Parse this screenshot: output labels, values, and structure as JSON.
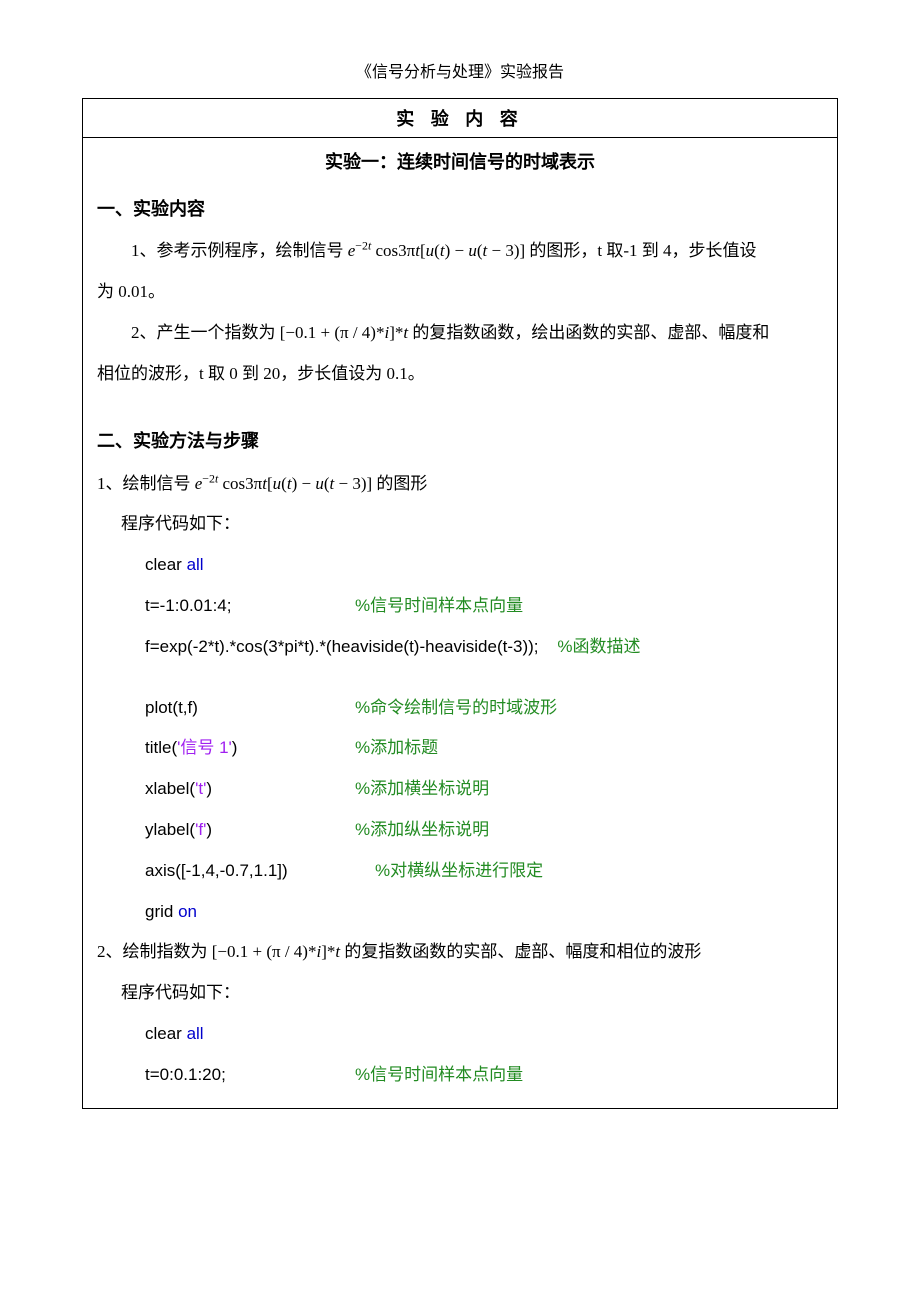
{
  "header": "《信号分析与处理》实验报告",
  "box_title": "实 验 内 容",
  "experiment_title": "实验一：连续时间信号的时域表示",
  "s1": {
    "heading": "一、实验内容",
    "item1_pre": "1、参考示例程序，绘制信号",
    "item1_formula_html": "<span class='formula'>e</span><sup>−2<span class='formula'>t</span></sup> cos3π<span class='formula'>t</span>[<span class='formula'>u</span>(<span class='formula'>t</span>) − <span class='formula'>u</span>(<span class='formula'>t</span> − 3)]",
    "item1_post": "的图形，t 取-1 到 4，步长值设",
    "item1_tail": "为 0.01。",
    "item2_pre": "2、产生一个指数为",
    "item2_formula_html": "[−0.1 + (π / 4)*<span class='formula'>i</span>]*<span class='formula'>t</span>",
    "item2_post": "的复指数函数，绘出函数的实部、虚部、幅度和",
    "item2_tail": "相位的波形，t 取 0 到 20，步长值设为 0.1。"
  },
  "s2": {
    "heading": "二、实验方法与步骤",
    "p1_pre": "1、绘制信号",
    "p1_formula_html": "<span class='formula'>e</span><sup>−2<span class='formula'>t</span></sup> cos3π<span class='formula'>t</span>[<span class='formula'>u</span>(<span class='formula'>t</span>) − <span class='formula'>u</span>(<span class='formula'>t</span> − 3)]",
    "p1_post": "的图形",
    "code_intro": "程序代码如下：",
    "code1": {
      "l1a": "clear ",
      "l1b": "all",
      "l2a": "t=-1:0.01:4;",
      "l2c": "%信号时间样本点向量",
      "l3a": "f=exp(-2*t).*cos(3*pi*t).*(heaviside(t)-heaviside(t-3));",
      "l3c": "%函数描述",
      "l4a": "plot(t,f)",
      "l4c": "%命令绘制信号的时域波形",
      "l5a": "title(",
      "l5s": "'信号 1'",
      "l5b": ")",
      "l5c": "%添加标题",
      "l6a": "xlabel(",
      "l6s": "'t'",
      "l6b": ")",
      "l6c": "%添加横坐标说明",
      "l7a": "ylabel(",
      "l7s": "'f'",
      "l7b": ")",
      "l7c": "%添加纵坐标说明",
      "l8a": "axis([-1,4,-0.7,1.1])",
      "l8c": "%对横纵坐标进行限定",
      "l9a": "grid ",
      "l9b": "on"
    },
    "p2_pre": "2、绘制指数为",
    "p2_formula_html": "[−0.1 + (π / 4)*<span class='formula'>i</span>]*<span class='formula'>t</span>",
    "p2_post": "的复指数函数的实部、虚部、幅度和相位的波形",
    "code2": {
      "l1a": "clear ",
      "l1b": "all",
      "l2a": "t=0:0.1:20;",
      "l2c": "%信号时间样本点向量"
    }
  }
}
